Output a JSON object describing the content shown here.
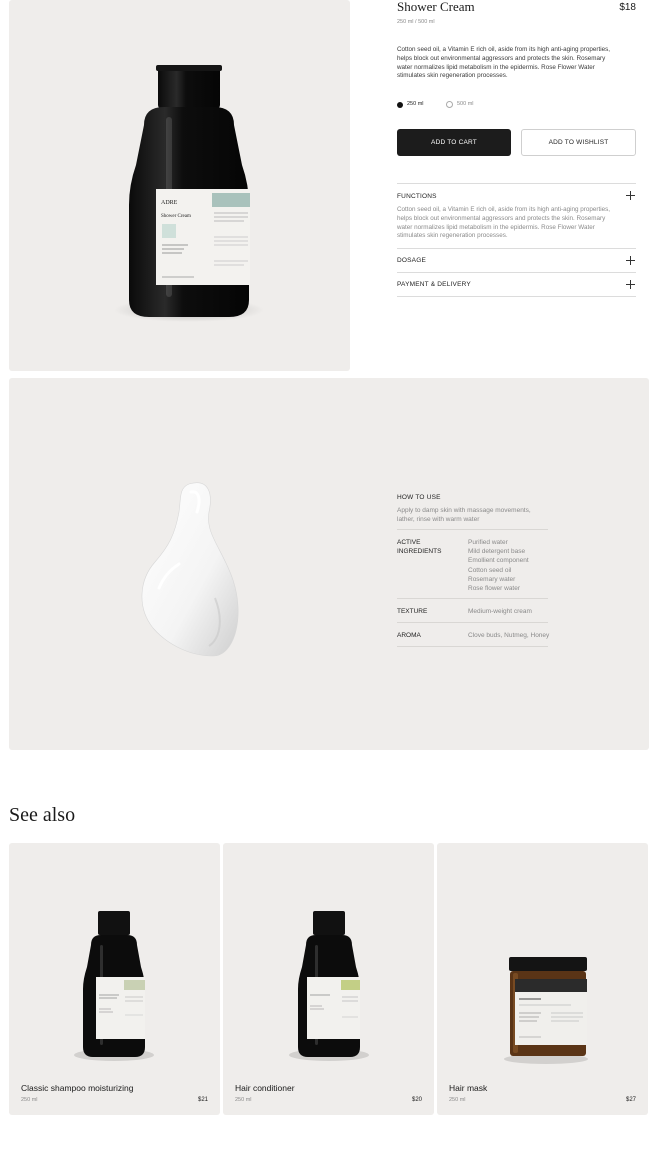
{
  "product": {
    "title": "Shower Cream",
    "price": "$18",
    "sizes_line": "250 ml / 500 ml",
    "description": "Cotton seed oil, a Vitamin E rich oil, aside from its high anti-aging properties, helps block out environmental aggressors and protects the skin. Rosemary water normalizes lipid metabolism in the epidermis. Rose Flower Water stimulates skin regeneration processes.",
    "size_options": [
      {
        "label": "250 ml",
        "selected": true
      },
      {
        "label": "500 ml",
        "selected": false
      }
    ],
    "add_to_cart": "ADD TO CART",
    "add_to_wishlist": "ADD TO WISHLIST",
    "bottle_label": {
      "brand": "ADRE",
      "name": "Shower Cream"
    }
  },
  "accordion": {
    "functions": {
      "title": "FUNCTIONS",
      "body": "Cotton seed oil, a Vitamin E rich oil, aside from its high anti-aging properties, helps block out environmental aggressors and protects the skin. Rosemary water normalizes lipid metabolism in the epidermis. Rose Flower Water stimulates skin regeneration processes."
    },
    "dosage": {
      "title": "DOSAGE"
    },
    "payment": {
      "title": "PAYMENT & DELIVERY"
    }
  },
  "usage": {
    "how_title": "HOW TO USE",
    "how_text": "Apply to damp skin with massage movements, lather, rinse with warm water",
    "active_label": "ACTIVE INGREDIENTS",
    "ingredients": [
      "Purified water",
      "Mild detergent base",
      "Emollient component",
      "Cotton seed oil",
      "Rosemary water",
      "Rose flower water"
    ],
    "texture_label": "TEXTURE",
    "texture_value": "Medium-weight cream",
    "aroma_label": "AROMA",
    "aroma_value": "Clove buds, Nutmeg, Honey"
  },
  "see_also": {
    "title": "See also",
    "items": [
      {
        "name": "Classic shampoo moisturizing",
        "size": "250 ml",
        "price": "$21",
        "label_color": "#c9d1b4"
      },
      {
        "name": "Hair conditioner",
        "size": "250 ml",
        "price": "$20",
        "label_color": "#c3cf86"
      },
      {
        "name": "Hair mask",
        "size": "250 ml",
        "price": "$27",
        "label_color": "#2b2b2b"
      }
    ]
  },
  "colors": {
    "panel": "#efedeb",
    "button_dark": "#1c1c1c",
    "label_accent": "#a9c2bc"
  }
}
